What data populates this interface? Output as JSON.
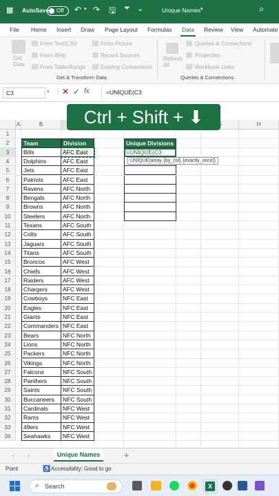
{
  "title_bar": {
    "autosave_label": "AutoSave",
    "autosave_state": "Off",
    "filename": "Unique Names",
    "colors": {
      "brand": "#1e7145"
    }
  },
  "menu": {
    "items": [
      "File",
      "Home",
      "Insert",
      "Draw",
      "Page Layout",
      "Formulas",
      "Data",
      "Review",
      "View",
      "Automate"
    ],
    "active": "Data"
  },
  "ribbon": {
    "get_data_label": "Get Data",
    "from_text_csv": "From Text/CSV",
    "from_web": "From Web",
    "from_table_range": "From Table/Range",
    "from_picture": "From Picture",
    "recent_sources": "Recent Sources",
    "existing_connections": "Existing Connections",
    "group1": "Get & Transform Data",
    "refresh_all": "Refresh All",
    "queries_connections": "Queries & Connections",
    "properties": "Properties",
    "workbook_links": "Workbook Links",
    "group2": "Queries & Connections"
  },
  "formula_bar": {
    "name_box": "C3",
    "fx_label": "fx",
    "formula": "=UNIQUE(C3"
  },
  "shortcut_banner": "Ctrl + Shift + ⬇",
  "columns": [
    "A",
    "B",
    "C",
    "D",
    "E",
    "F",
    "G",
    "H"
  ],
  "row_numbers": [
    1,
    2,
    3,
    4,
    5,
    6,
    7,
    8,
    9,
    10,
    11,
    12,
    13,
    14,
    15,
    16,
    17,
    18,
    19,
    20,
    21,
    22,
    23,
    24,
    25,
    26,
    27,
    28,
    29,
    30,
    31,
    32,
    33,
    34
  ],
  "table": {
    "headers": [
      "Team",
      "Division"
    ],
    "rows": [
      [
        "Bills",
        "AFC East"
      ],
      [
        "Dolphins",
        "AFC East"
      ],
      [
        "Jets",
        "AFC East"
      ],
      [
        "Patriots",
        "AFC East"
      ],
      [
        "Ravens",
        "AFC North"
      ],
      [
        "Bengals",
        "AFC North"
      ],
      [
        "Browns",
        "AFC North"
      ],
      [
        "Steelers",
        "AFC North"
      ],
      [
        "Texans",
        "AFC South"
      ],
      [
        "Colts",
        "AFC South"
      ],
      [
        "Jaguars",
        "AFC South"
      ],
      [
        "Titans",
        "AFC South"
      ],
      [
        "Broncos",
        "AFC West"
      ],
      [
        "Chiefs",
        "AFC West"
      ],
      [
        "Raiders",
        "AFC West"
      ],
      [
        "Chargers",
        "AFC West"
      ],
      [
        "Cowboys",
        "NFC East"
      ],
      [
        "Eagles",
        "NFC East"
      ],
      [
        "Giants",
        "NFC East"
      ],
      [
        "Commanders",
        "NFC East"
      ],
      [
        "Bears",
        "NFC North"
      ],
      [
        "Lions",
        "NFC North"
      ],
      [
        "Packers",
        "NFC North"
      ],
      [
        "Vikings",
        "NFC North"
      ],
      [
        "Falcons",
        "NFC South"
      ],
      [
        "Panthers",
        "NFC South"
      ],
      [
        "Saints",
        "NFC South"
      ],
      [
        "Buccaneers",
        "NFC South"
      ],
      [
        "Cardinals",
        "NFC West"
      ],
      [
        "Rams",
        "NFC West"
      ],
      [
        "49ers",
        "NFC West"
      ],
      [
        "Seahawks",
        "NFC West"
      ]
    ]
  },
  "unique_divisions": {
    "header": "Unique Divisions",
    "editing_value": "=UNIQUE(C3",
    "tooltip": "UNIQUE(array, [by_col], [exactly_once])"
  },
  "sheet_tabs": {
    "active": "Unique Names",
    "add_label": "+"
  },
  "status_bar": {
    "mode": "Point",
    "accessibility": "Accessibility: Good to go"
  },
  "taskbar": {
    "search_placeholder": "Search"
  }
}
